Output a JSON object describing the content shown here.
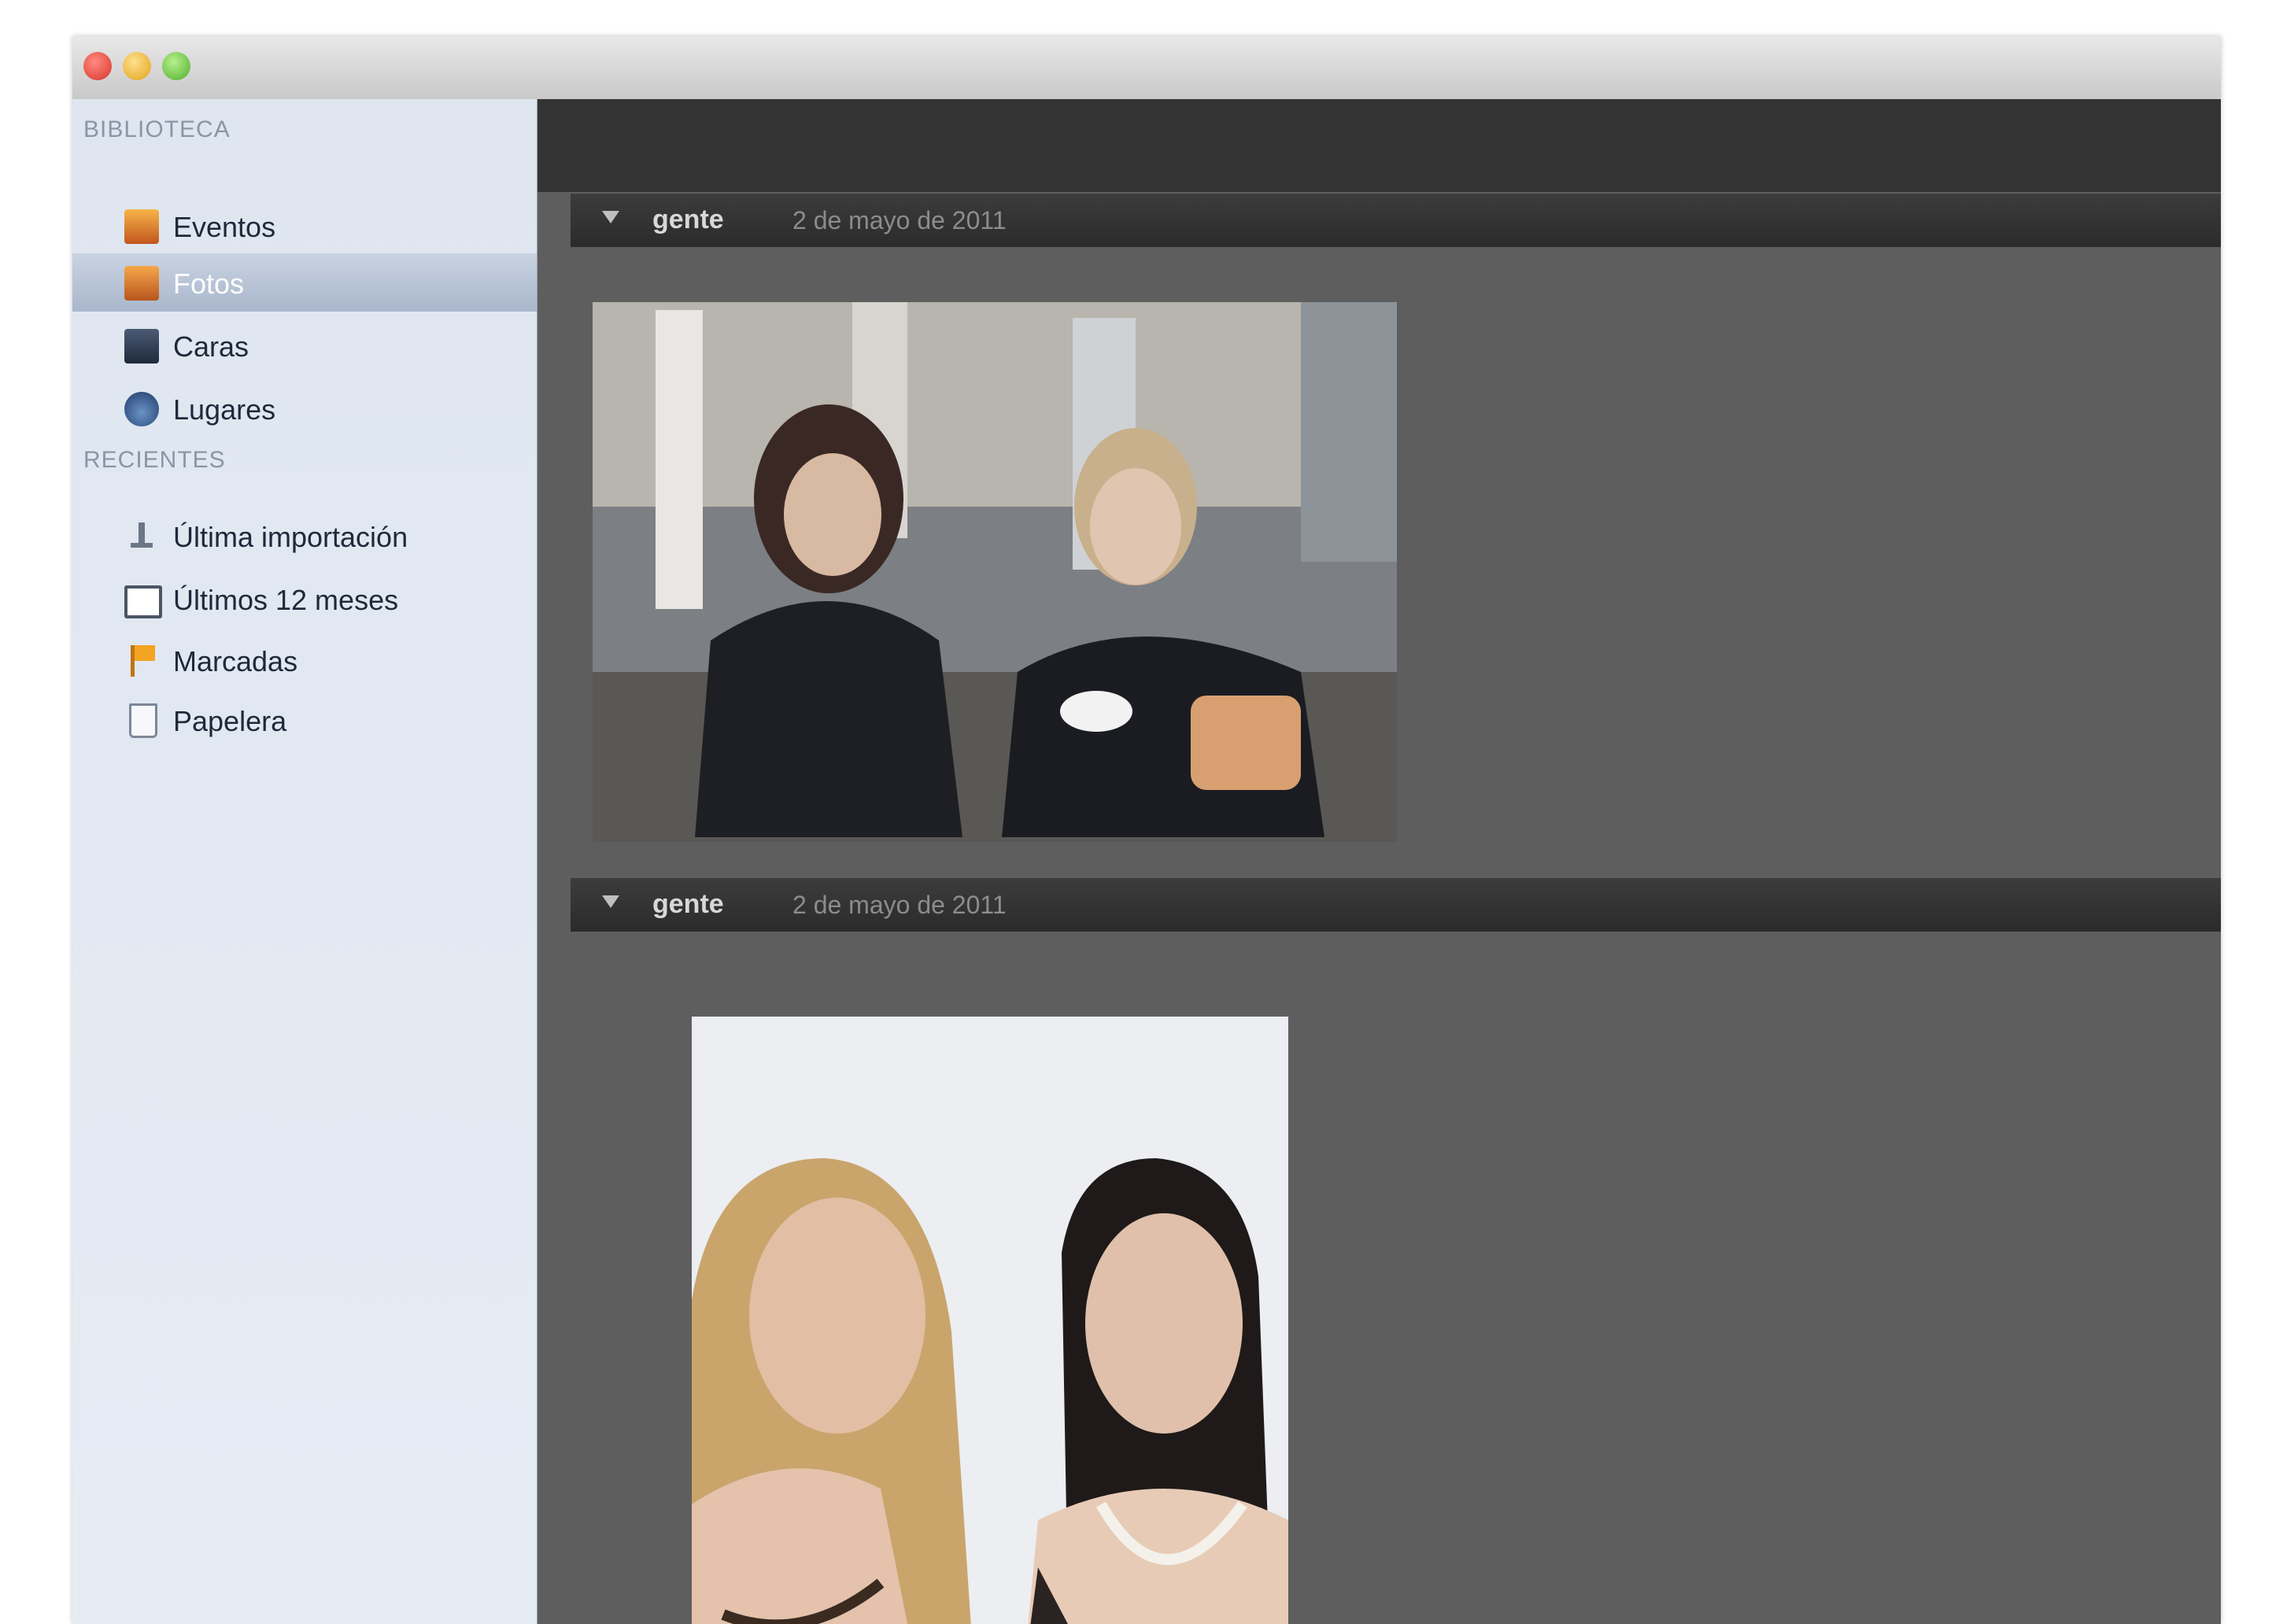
{
  "window": {
    "controls": [
      "close",
      "minimize",
      "zoom"
    ]
  },
  "sidebar": {
    "library_header": "BIBLIOTECA",
    "recent_header": "RECIENTES",
    "library_items": [
      {
        "label": "Eventos",
        "icon": "events-icon"
      },
      {
        "label": "Fotos",
        "icon": "photos-icon",
        "selected": true
      },
      {
        "label": "Caras",
        "icon": "faces-icon"
      },
      {
        "label": "Lugares",
        "icon": "places-icon"
      }
    ],
    "recent_items": [
      {
        "label": "Última importación",
        "icon": "last-import-icon"
      },
      {
        "label": "Últimos 12 meses",
        "icon": "calendar-icon"
      },
      {
        "label": "Marcadas",
        "icon": "flag-icon"
      },
      {
        "label": "Papelera",
        "icon": "trash-icon"
      }
    ]
  },
  "events": [
    {
      "name": "gente",
      "date": "2 de mayo de 2011"
    },
    {
      "name": "gente",
      "date": "2 de mayo de 2011"
    }
  ],
  "colors": {
    "sidebar_bg": "#e3e9f2",
    "selection": "#a9b7cc",
    "content_bg": "#5e5e5e",
    "event_bar": "#2f2f2f"
  }
}
